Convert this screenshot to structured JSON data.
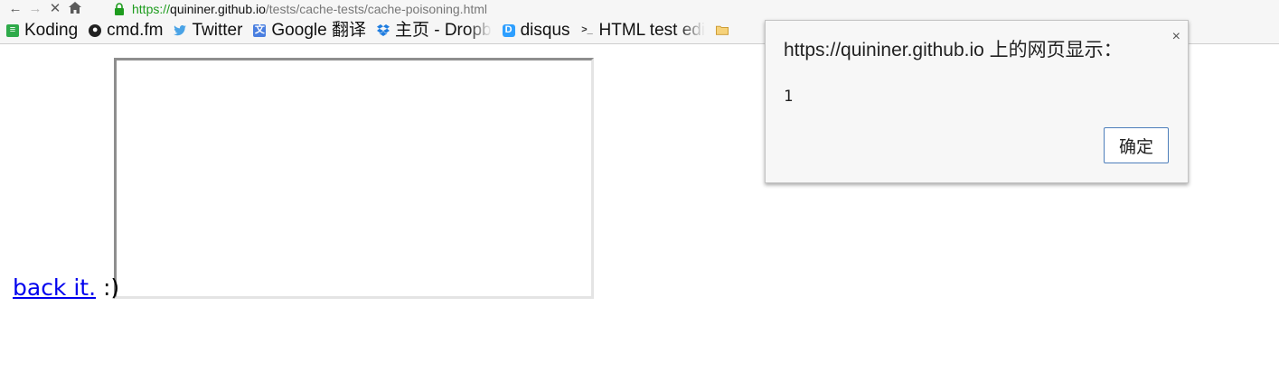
{
  "browser": {
    "nav": {
      "back_icon": "arrow-left-icon",
      "forward_icon": "arrow-right-icon",
      "stop_icon": "close-icon",
      "home_icon": "home-icon"
    },
    "url": {
      "scheme": "https://",
      "host": "quininer.github.io",
      "path": "/tests/cache-tests/cache-poisoning.html",
      "secure_color": "#1e9c1e"
    },
    "bookmarks": [
      {
        "label": "Koding",
        "icon": "koding-icon"
      },
      {
        "label": "cmd.fm",
        "icon": "cmdfm-icon"
      },
      {
        "label": "Twitter",
        "icon": "twitter-icon"
      },
      {
        "label": "Google 翻译",
        "icon": "google-translate-icon"
      },
      {
        "label": "主页 - Dropb",
        "icon": "dropbox-icon"
      },
      {
        "label": "disqus",
        "icon": "disqus-icon"
      },
      {
        "label": "HTML test edi",
        "icon": "terminal-icon"
      },
      {
        "label": "",
        "icon": "folder-icon"
      }
    ]
  },
  "page": {
    "link_text": "back it.",
    "trailing_text": " :)"
  },
  "dialog": {
    "title": "https://quininer.github.io 上的网页显示：",
    "message": "1",
    "ok_label": "确定",
    "close_glyph": "×",
    "button_border_color": "#4d7ebb"
  }
}
